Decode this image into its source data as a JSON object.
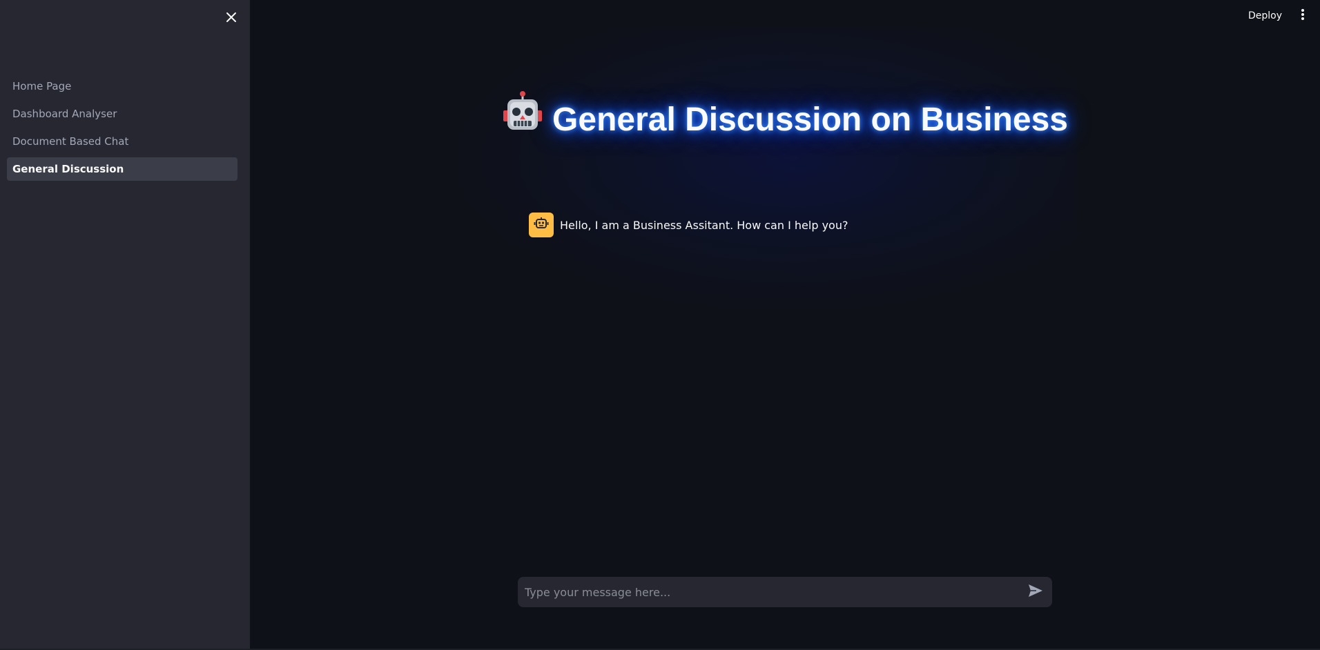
{
  "sidebar": {
    "close_icon": "close-icon",
    "items": [
      {
        "label": "Home Page",
        "active": false
      },
      {
        "label": "Dashboard Analyser",
        "active": false
      },
      {
        "label": "Document Based Chat",
        "active": false
      },
      {
        "label": "General Discussion",
        "active": true
      }
    ]
  },
  "header": {
    "deploy_label": "Deploy",
    "menu_icon": "more-vertical-icon"
  },
  "main": {
    "title": "General Discussion on Business",
    "title_icon": "robot-face-emoji",
    "messages": [
      {
        "role": "assistant",
        "avatar_icon": "bot-icon",
        "text": "Hello, I am a Business Assitant. How can I help you?"
      }
    ],
    "chat_input": {
      "placeholder": "Type your message here...",
      "value": "",
      "send_icon": "send-icon"
    }
  },
  "colors": {
    "background": "#0e1117",
    "sidebar": "#262730",
    "active_nav": "#3b3d48",
    "avatar": "#ffbd45",
    "glow": "#1f5fff",
    "text": "#fafafa"
  }
}
